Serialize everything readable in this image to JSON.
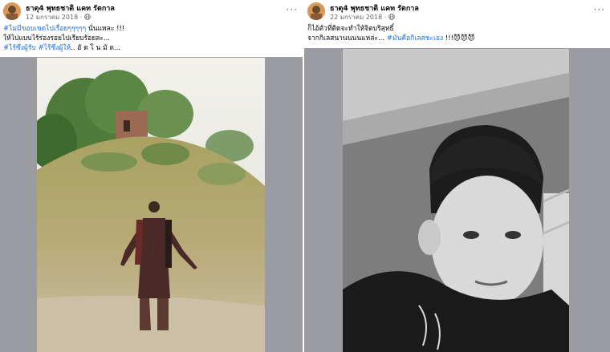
{
  "posts": [
    {
      "author": "ธาตุ4 พุทธชาติ แคท รัตกาล",
      "date": "12 มกราคม 2018 ·",
      "more": "···",
      "caption": [
        {
          "tag": "#ไม่มีขอบเขตไปเรื่อยๆๆๆๆๆ",
          "text": " นั่นแหละ !!!"
        },
        {
          "tag": "",
          "text": "ให้ไปแบบไร้ร่องรอยไปเรียบร้อยละ..."
        },
        {
          "tag": "#ไร้ซึ่งผู้รับ #ไร้ซึ่งผู้ให้",
          "text": ".. อั ต โ น มั ต..."
        }
      ]
    },
    {
      "author": "ธาตุ4 พุทธชาติ แคท รัตกาล",
      "date": "22 มกราคม 2018 ·",
      "more": "···",
      "caption": [
        {
          "tag": "",
          "text": "ก็ไอ้ตัวที่ติดจะทำให้จิตบริสุทธิ์"
        },
        {
          "tag": "",
          "text": "จากกิเลสนานนนนแหล่ะ... ",
          "tag2": "#มันคือกิเลสชะเอง",
          "text2": " !!!😈😈😈"
        }
      ]
    }
  ],
  "colors": {
    "link": "#216fdb",
    "frame": "#9a9ca2"
  }
}
